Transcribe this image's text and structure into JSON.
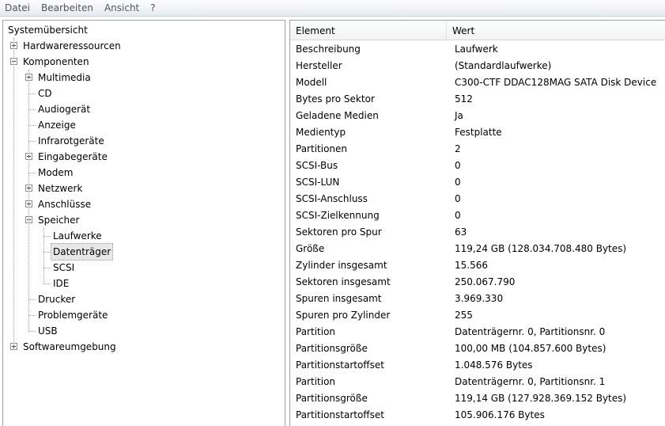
{
  "menu": [
    "Datei",
    "Bearbeiten",
    "Ansicht",
    "?"
  ],
  "tree": [
    {
      "label": "Systemübersicht",
      "depth": 0,
      "expander": "none"
    },
    {
      "label": "Hardwareressourcen",
      "depth": 1,
      "expander": "plus"
    },
    {
      "label": "Komponenten",
      "depth": 1,
      "expander": "minus"
    },
    {
      "label": "Multimedia",
      "depth": 2,
      "expander": "plus"
    },
    {
      "label": "CD",
      "depth": 2,
      "expander": "none"
    },
    {
      "label": "Audiogerät",
      "depth": 2,
      "expander": "none"
    },
    {
      "label": "Anzeige",
      "depth": 2,
      "expander": "none"
    },
    {
      "label": "Infrarotgeräte",
      "depth": 2,
      "expander": "none"
    },
    {
      "label": "Eingabegeräte",
      "depth": 2,
      "expander": "plus"
    },
    {
      "label": "Modem",
      "depth": 2,
      "expander": "none"
    },
    {
      "label": "Netzwerk",
      "depth": 2,
      "expander": "plus"
    },
    {
      "label": "Anschlüsse",
      "depth": 2,
      "expander": "plus"
    },
    {
      "label": "Speicher",
      "depth": 2,
      "expander": "minus"
    },
    {
      "label": "Laufwerke",
      "depth": 3,
      "expander": "none"
    },
    {
      "label": "Datenträger",
      "depth": 3,
      "expander": "none",
      "selected": true
    },
    {
      "label": "SCSI",
      "depth": 3,
      "expander": "none"
    },
    {
      "label": "IDE",
      "depth": 3,
      "expander": "none"
    },
    {
      "label": "Drucker",
      "depth": 2,
      "expander": "none"
    },
    {
      "label": "Problemgeräte",
      "depth": 2,
      "expander": "none"
    },
    {
      "label": "USB",
      "depth": 2,
      "expander": "none"
    },
    {
      "label": "Softwareumgebung",
      "depth": 1,
      "expander": "plus"
    }
  ],
  "columns": {
    "element": "Element",
    "value": "Wert"
  },
  "rows": [
    {
      "element": "Beschreibung",
      "value": "Laufwerk"
    },
    {
      "element": "Hersteller",
      "value": "(Standardlaufwerke)"
    },
    {
      "element": "Modell",
      "value": "C300-CTF DDAC128MAG SATA Disk Device"
    },
    {
      "element": "Bytes pro Sektor",
      "value": "512"
    },
    {
      "element": "Geladene Medien",
      "value": "Ja"
    },
    {
      "element": "Medientyp",
      "value": "Festplatte"
    },
    {
      "element": "Partitionen",
      "value": "2"
    },
    {
      "element": "SCSI-Bus",
      "value": "0"
    },
    {
      "element": "SCSI-LUN",
      "value": "0"
    },
    {
      "element": "SCSI-Anschluss",
      "value": "0"
    },
    {
      "element": "SCSI-Zielkennung",
      "value": "0"
    },
    {
      "element": "Sektoren pro Spur",
      "value": "63"
    },
    {
      "element": "Größe",
      "value": "119,24 GB (128.034.708.480 Bytes)"
    },
    {
      "element": "Zylinder insgesamt",
      "value": "15.566"
    },
    {
      "element": "Sektoren insgesamt",
      "value": "250.067.790"
    },
    {
      "element": "Spuren insgesamt",
      "value": "3.969.330"
    },
    {
      "element": "Spuren pro Zylinder",
      "value": "255"
    },
    {
      "element": "Partition",
      "value": "Datenträgernr. 0, Partitionsnr. 0"
    },
    {
      "element": "Partitionsgröße",
      "value": "100,00 MB (104.857.600 Bytes)"
    },
    {
      "element": "Partitionstartoffset",
      "value": "1.048.576 Bytes"
    },
    {
      "element": "Partition",
      "value": "Datenträgernr. 0, Partitionsnr. 1"
    },
    {
      "element": "Partitionsgröße",
      "value": "119,14 GB (127.928.369.152 Bytes)"
    },
    {
      "element": "Partitionstartoffset",
      "value": "105.906.176 Bytes"
    }
  ]
}
